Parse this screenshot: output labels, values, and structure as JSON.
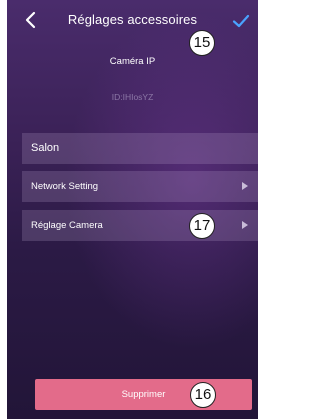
{
  "header": {
    "title": "Réglages accessoires"
  },
  "device": {
    "name": "Caméra IP",
    "id": "ID:IHIosYZ"
  },
  "name_field": {
    "value": "Salon"
  },
  "menu": {
    "items": [
      {
        "label": "Network Setting"
      },
      {
        "label": "Réglage Camera"
      }
    ]
  },
  "actions": {
    "delete_label": "Supprimer"
  },
  "annotations": {
    "callout_15": "15",
    "callout_16": "16",
    "callout_17": "17"
  },
  "colors": {
    "accent_check": "#4aa3ff",
    "delete_button": "#e36b8a",
    "background_top": "#4a2c6c",
    "background_bottom": "#221538"
  }
}
